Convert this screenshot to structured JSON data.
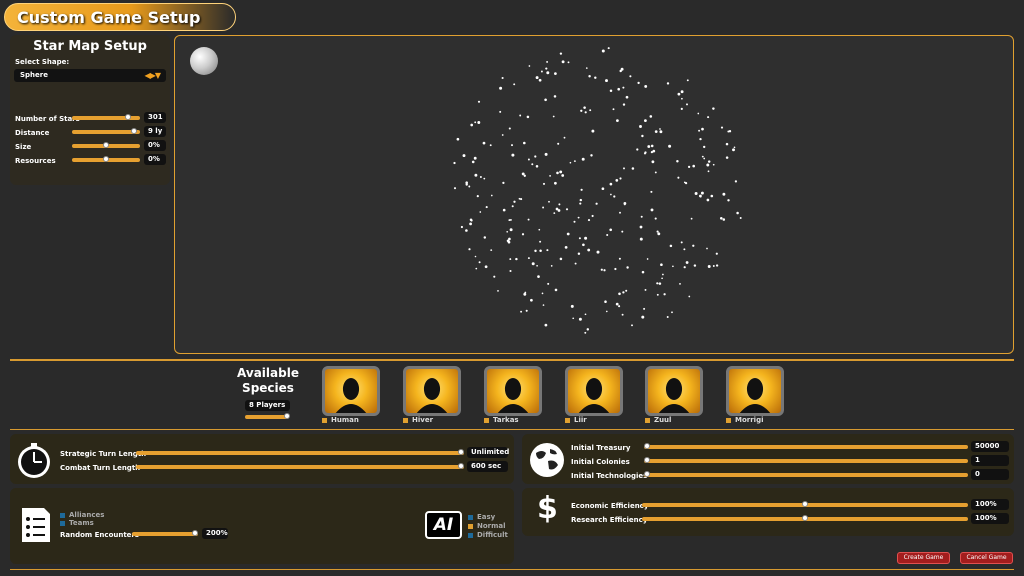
{
  "title": "Custom Game Setup",
  "star_map": {
    "title": "Star Map Setup",
    "shape_label": "Select Shape:",
    "shape_value": "Sphere",
    "sliders": [
      {
        "label": "Number of Stars",
        "value": "301",
        "level": 0.85
      },
      {
        "label": "Distance",
        "value": "9 ly",
        "level": 0.95
      },
      {
        "label": "Size",
        "value": "0%",
        "level": 0.5
      },
      {
        "label": "Resources",
        "value": "0%",
        "level": 0.5
      }
    ]
  },
  "species": {
    "title": "Available Species",
    "players": "8 Players",
    "list": [
      {
        "name": "Human",
        "icon": "human-portrait-icon"
      },
      {
        "name": "Hiver",
        "icon": "hiver-portrait-icon"
      },
      {
        "name": "Tarkas",
        "icon": "tarkas-portrait-icon"
      },
      {
        "name": "Liir",
        "icon": "liir-portrait-icon"
      },
      {
        "name": "Zuul",
        "icon": "zuul-portrait-icon"
      },
      {
        "name": "Morrigi",
        "icon": "morrigi-portrait-icon"
      }
    ]
  },
  "turns": {
    "strategic_label": "Strategic Turn Length",
    "strategic_value": "Unlimited",
    "strategic_level": 1.0,
    "combat_label": "Combat Turn Length",
    "combat_value": "600 sec",
    "combat_level": 1.0
  },
  "options": {
    "alliances": "Alliances",
    "teams": "Teams",
    "encounters_label": "Random Encounters",
    "encounters_value": "200%",
    "encounters_level": 1.0,
    "ai_icon": "AI",
    "ai_levels": [
      "Easy",
      "Normal",
      "Difficult"
    ],
    "ai_selected": "Normal"
  },
  "economy": {
    "treasury_label": "Initial Treasury",
    "treasury_value": "50000",
    "treasury_level": 0.0,
    "colonies_label": "Initial Colonies",
    "colonies_value": "1",
    "colonies_level": 0.0,
    "tech_label": "Initial Technologies",
    "tech_value": "0",
    "tech_level": 0.0
  },
  "efficiency": {
    "economic_label": "Economic Efficiency",
    "economic_value": "100%",
    "economic_level": 0.5,
    "research_label": "Research Efficiency",
    "research_value": "100%",
    "research_level": 0.5
  },
  "buttons": {
    "create": "Create Game",
    "cancel": "Cancel Game"
  },
  "colors": {
    "accent": "#e6a030",
    "panel": "#2e2a20",
    "button": "#a31d1d"
  }
}
